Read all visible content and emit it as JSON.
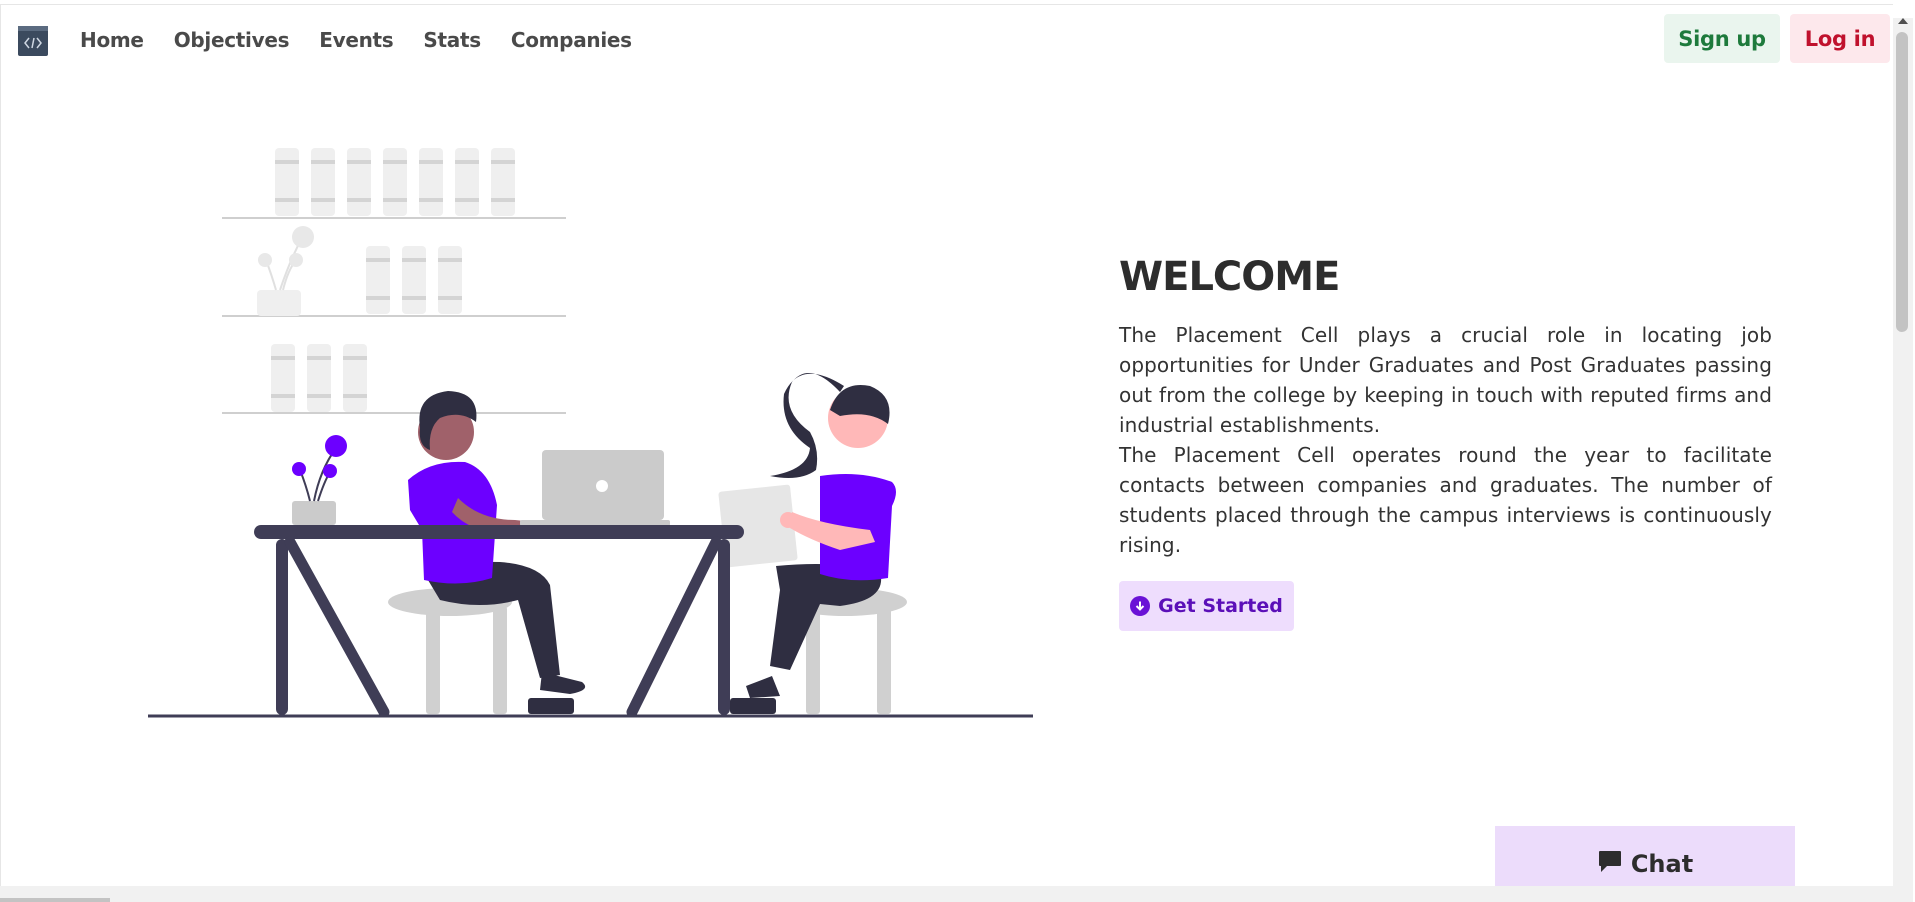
{
  "nav": {
    "logo_icon": "code-icon",
    "links": [
      {
        "label": "Home"
      },
      {
        "label": "Objectives"
      },
      {
        "label": "Events"
      },
      {
        "label": "Stats"
      },
      {
        "label": "Companies"
      }
    ],
    "signup_label": "Sign up",
    "login_label": "Log in"
  },
  "hero": {
    "title": "WELCOME",
    "paragraphs": [
      "The Placement Cell plays a crucial role in locating job opportunities for Under Graduates and Post Graduates passing out from the college by keeping in touch with reputed firms and industrial establishments.",
      "The Placement Cell operates round the year to facilitate contacts between companies and graduates. The number of students placed through the campus interviews is continuously rising."
    ],
    "cta_label": "Get Started",
    "cta_icon": "arrow-down-circle-icon"
  },
  "chat": {
    "label": "Chat",
    "icon": "chat-bubble-icon"
  },
  "colors": {
    "accent": "#6c00ff",
    "signup_bg": "#eaf5ee",
    "signup_text": "#1e7a3c",
    "login_bg": "#fde8ec",
    "login_text": "#c0112d",
    "cta_bg": "#eeddfd",
    "chat_bg": "#ecdcfb"
  }
}
